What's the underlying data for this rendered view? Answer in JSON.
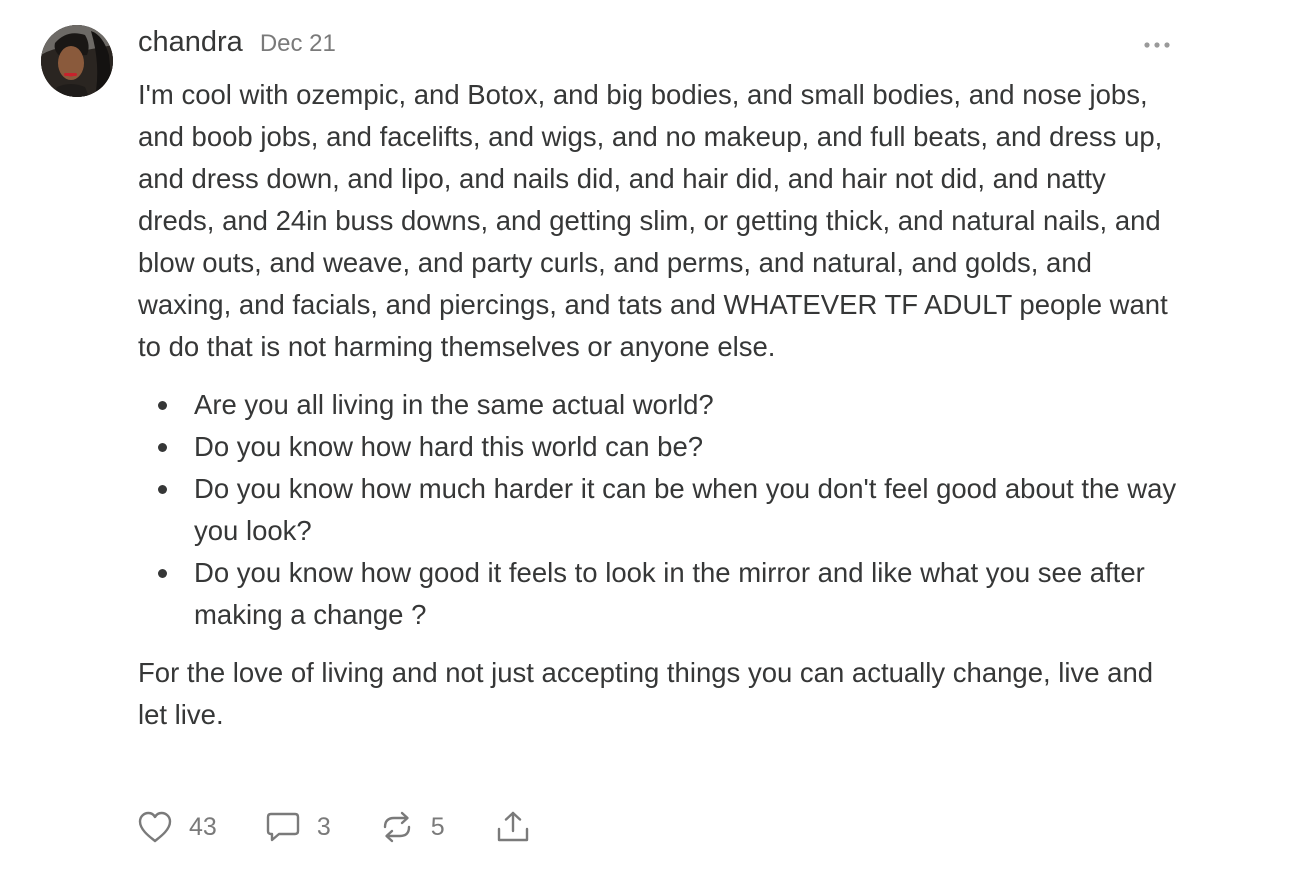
{
  "post": {
    "author": "chandra",
    "date": "Dec 21",
    "more_label": "•••",
    "intro": "I'm cool with ozempic, and Botox, and big bodies, and small bodies, and nose jobs, and boob jobs, and facelifts, and wigs, and no makeup, and full beats, and dress up, and dress down, and lipo, and nails did, and hair did, and hair not did, and natty dreds, and 24in buss downs, and getting slim, or getting thick, and natural nails, and blow outs, and weave, and party curls, and perms, and natural, and golds, and waxing, and facials, and piercings, and tats and WHATEVER TF ADULT people want to do that is not harming themselves or anyone else.",
    "bullets": [
      "Are you all living in the same actual world?",
      "Do you know how hard this world can be?",
      "Do you know how much harder it can be when you don't feel good about the way you look?",
      "Do you know how good it feels to look in the mirror and like what you see after making a change ?"
    ],
    "closing": "For the love of living and not just accepting things you can actually change, live and let live."
  },
  "actions": {
    "likes": "43",
    "comments": "3",
    "restacks": "5"
  },
  "icons": {
    "like": "heart-icon",
    "comment": "speech-bubble-icon",
    "restack": "restack-arrows-icon",
    "share": "share-upload-icon",
    "more": "ellipsis-icon"
  },
  "colors": {
    "text": "#363737",
    "muted": "#7a7a7a",
    "background": "#ffffff"
  }
}
